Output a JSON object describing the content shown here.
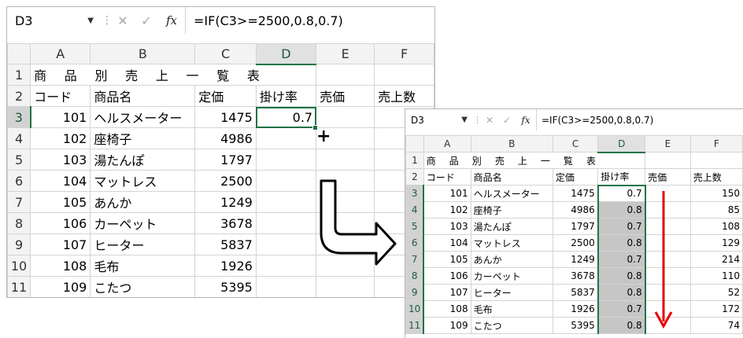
{
  "before": {
    "name_box": "D3",
    "formula": "=IF(C3>=2500,0.8,0.7)",
    "columns": [
      "A",
      "B",
      "C",
      "D",
      "E",
      "F"
    ],
    "selected_column": "D",
    "title": "商 品 別 売 上 一 覧 表",
    "headers": [
      "コード",
      "商品名",
      "定価",
      "掛け率",
      "売価",
      "売上数"
    ],
    "rows": [
      {
        "row": "3",
        "code": "101",
        "name": "ヘルスメーター",
        "price": "1475",
        "rate": "0.7"
      },
      {
        "row": "4",
        "code": "102",
        "name": "座椅子",
        "price": "4986",
        "rate": ""
      },
      {
        "row": "5",
        "code": "103",
        "name": "湯たんぽ",
        "price": "1797",
        "rate": ""
      },
      {
        "row": "6",
        "code": "104",
        "name": "マットレス",
        "price": "2500",
        "rate": ""
      },
      {
        "row": "7",
        "code": "105",
        "name": "あんか",
        "price": "1249",
        "rate": ""
      },
      {
        "row": "8",
        "code": "106",
        "name": "カーペット",
        "price": "3678",
        "rate": ""
      },
      {
        "row": "9",
        "code": "107",
        "name": "ヒーター",
        "price": "5837",
        "rate": ""
      },
      {
        "row": "10",
        "code": "108",
        "name": "毛布",
        "price": "1926",
        "rate": ""
      },
      {
        "row": "11",
        "code": "109",
        "name": "こたつ",
        "price": "5395",
        "rate": ""
      }
    ]
  },
  "after": {
    "name_box": "D3",
    "formula": "=IF(C3>=2500,0.8,0.7)",
    "columns": [
      "A",
      "B",
      "C",
      "D",
      "E",
      "F"
    ],
    "title": "商 品 別 売 上 一 覧 表",
    "headers": [
      "コード",
      "商品名",
      "定価",
      "掛け率",
      "売価",
      "売上数"
    ],
    "rows": [
      {
        "row": "3",
        "code": "101",
        "name": "ヘルスメーター",
        "price": "1475",
        "rate": "0.7",
        "qty": "150"
      },
      {
        "row": "4",
        "code": "102",
        "name": "座椅子",
        "price": "4986",
        "rate": "0.8",
        "qty": "85"
      },
      {
        "row": "5",
        "code": "103",
        "name": "湯たんぽ",
        "price": "1797",
        "rate": "0.7",
        "qty": "108"
      },
      {
        "row": "6",
        "code": "104",
        "name": "マットレス",
        "price": "2500",
        "rate": "0.8",
        "qty": "129"
      },
      {
        "row": "7",
        "code": "105",
        "name": "あんか",
        "price": "1249",
        "rate": "0.7",
        "qty": "214"
      },
      {
        "row": "8",
        "code": "106",
        "name": "カーペット",
        "price": "3678",
        "rate": "0.8",
        "qty": "110"
      },
      {
        "row": "9",
        "code": "107",
        "name": "ヒーター",
        "price": "5837",
        "rate": "0.8",
        "qty": "52"
      },
      {
        "row": "10",
        "code": "108",
        "name": "毛布",
        "price": "1926",
        "rate": "0.7",
        "qty": "172"
      },
      {
        "row": "11",
        "code": "109",
        "name": "こたつ",
        "price": "5395",
        "rate": "0.8",
        "qty": "74"
      }
    ]
  },
  "icons": {
    "dropdown": "chevron-down-icon",
    "cancel": "cancel-x-icon",
    "enter": "check-icon",
    "function": "fx-icon",
    "fill_plus": "crosshair-plus-icon",
    "transition": "u-turn-arrow-icon",
    "fill_down": "down-arrow-icon"
  },
  "colors": {
    "accent": "#217346",
    "arrow": "#e60000",
    "shade": "#c6c6c6"
  }
}
